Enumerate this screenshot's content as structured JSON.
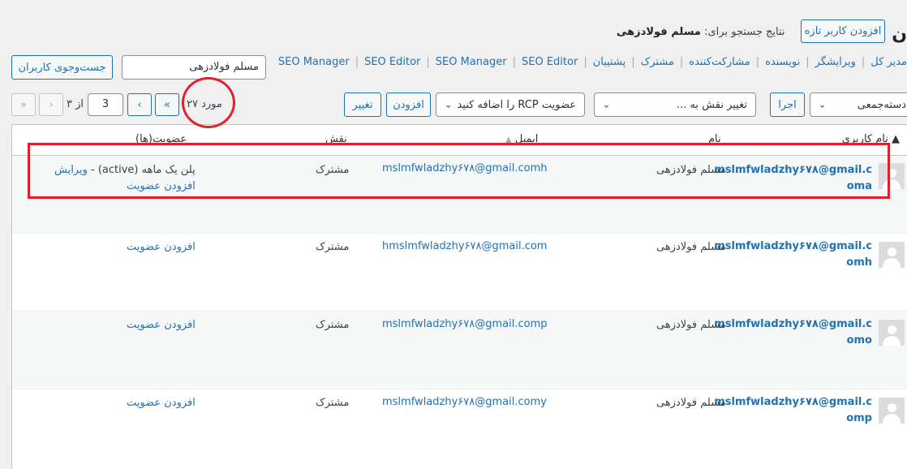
{
  "header": {
    "title_fragment": "ن",
    "add_new_label": "افزودن کاربر تازه",
    "search_results_prefix": "نتایج جستجو برای:",
    "search_results_term": "مسلم فولادزهی"
  },
  "search": {
    "value": "مسلم فولادزهی",
    "button_label": "جست‌وجوی کاربران"
  },
  "role_filters": [
    "مدیر کل",
    "ویرایشگر",
    "نویسنده",
    "مشارکت‌کننده",
    "مشترک",
    "پشتیبان",
    "SEO Manager",
    "SEO Editor",
    "SEO Manager",
    "SEO Editor"
  ],
  "bulk": {
    "bulk_action_label": "دسته‌جمعی",
    "apply_label": "اجرا",
    "change_role_label": "تغییر نقش به ...",
    "change_label": "تغییر",
    "rcp_label": "عضویت RCP را اضافه کنید",
    "add_label": "افزودن",
    "change2_label": "تغییر"
  },
  "pagination": {
    "items_count": "۲۷ مورد",
    "first": "«",
    "prev": "‹",
    "current": "3",
    "of_label": "از ۳",
    "next": "›",
    "last": "»"
  },
  "table": {
    "columns": {
      "username": "نام کاربری",
      "name": "نام",
      "email": "ایمیل",
      "role": "نقش",
      "memberships": "عضویت(ها)"
    },
    "rows": [
      {
        "username_line1": "mslmfwladzhy۶۷۸@gmail.c",
        "username_line2": "oma",
        "name": "مسلم فولادزهی",
        "email": "mslmfwladzhy۶۷۸@gmail.comh",
        "role": "مشترک",
        "membership": "پلن یک ماهه (active) - ",
        "edit_label": "ویرایش",
        "add_membership_label": "افزودن عضویت"
      },
      {
        "username_line1": "mslmfwladzhy۶۷۸@gmail.c",
        "username_line2": "omh",
        "name": "مسلم فولادزهی",
        "email": "hmslmfwladzhy۶۷۸@gmail.com",
        "role": "مشترک",
        "add_membership_label": "افزودن عضویت"
      },
      {
        "username_line1": "mslmfwladzhy۶۷۸@gmail.c",
        "username_line2": "omo",
        "name": "مسلم فولادزهی",
        "email": "mslmfwladzhy۶۷۸@gmail.comp",
        "role": "مشترک",
        "add_membership_label": "افزودن عضویت"
      },
      {
        "username_line1": "mslmfwladzhy۶۷۸@gmail.c",
        "username_line2": "omp",
        "name": "مسلم فولادزهی",
        "email": "mslmfwladzhy۶۷۸@gmail.comy",
        "role": "مشترک",
        "add_membership_label": "افزودن عضویت"
      }
    ]
  },
  "annotations": {
    "highlight_color": "#e2202b"
  }
}
